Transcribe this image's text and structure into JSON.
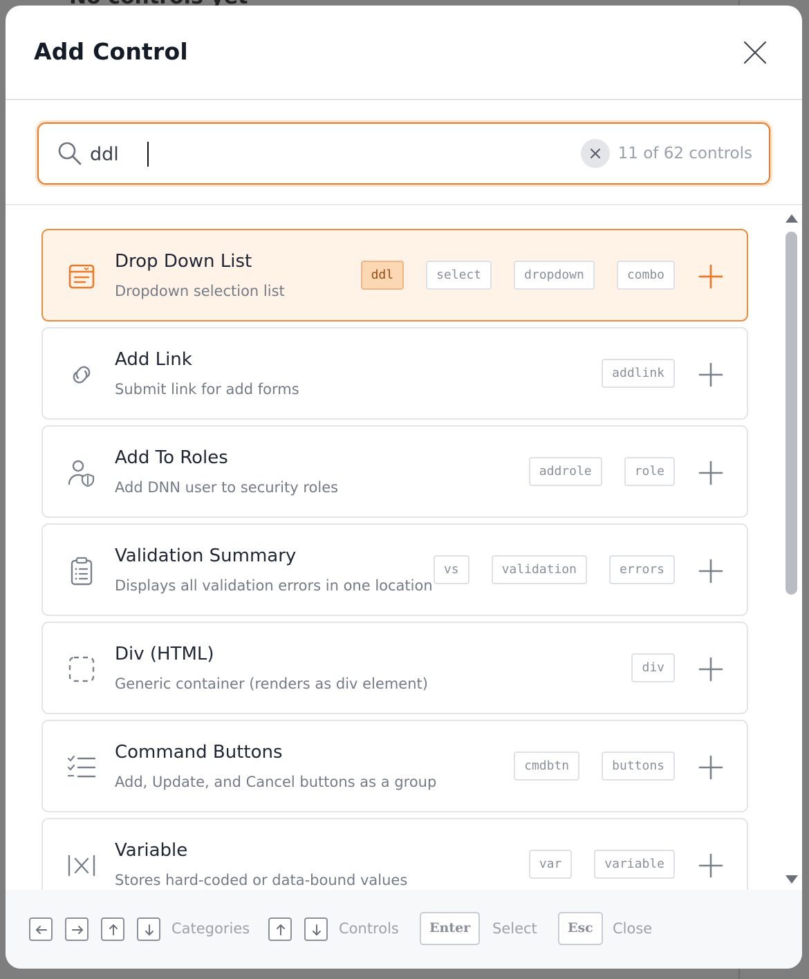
{
  "background": {
    "partial_heading": "No controls yet"
  },
  "dialog": {
    "title": "Add Control",
    "close_icon": "close-icon"
  },
  "search": {
    "value": "ddl",
    "placeholder": "",
    "count": "11 of 62 controls",
    "accent_color": "#ea7a27"
  },
  "controls": [
    {
      "title": "Drop Down List",
      "description": "Dropdown selection list",
      "icon": "dropdown-list-icon",
      "tags": [
        "ddl",
        "select",
        "dropdown",
        "combo"
      ],
      "highlighted_tag": "ddl",
      "selected": true
    },
    {
      "title": "Add Link",
      "description": "Submit link for add forms",
      "icon": "link-icon",
      "tags": [
        "addlink"
      ],
      "selected": false
    },
    {
      "title": "Add To Roles",
      "description": "Add DNN user to security roles",
      "icon": "user-shield-icon",
      "tags": [
        "addrole",
        "role"
      ],
      "selected": false
    },
    {
      "title": "Validation Summary",
      "description": "Displays all validation errors in one location",
      "icon": "clipboard-list-icon",
      "tags": [
        "vs",
        "validation",
        "errors"
      ],
      "selected": false
    },
    {
      "title": "Div (HTML)",
      "description": "Generic container (renders as div element)",
      "icon": "dashed-square-icon",
      "tags": [
        "div"
      ],
      "selected": false
    },
    {
      "title": "Command Buttons",
      "description": "Add, Update, and Cancel buttons as a group",
      "icon": "checklist-icon",
      "tags": [
        "cmdbtn",
        "buttons"
      ],
      "selected": false
    },
    {
      "title": "Variable",
      "description": "Stores hard-coded or data-bound values",
      "icon": "variable-icon",
      "tags": [
        "var",
        "variable"
      ],
      "selected": false
    }
  ],
  "footer": {
    "categories_label": "Categories",
    "controls_label": "Controls",
    "enter_key": "Enter",
    "select_label": "Select",
    "esc_key": "Esc",
    "close_label": "Close"
  },
  "colors": {
    "accent": "#ea7a27",
    "selected_bg": "#fff3e8",
    "tag_highlight_bg": "#fcd7b4"
  }
}
